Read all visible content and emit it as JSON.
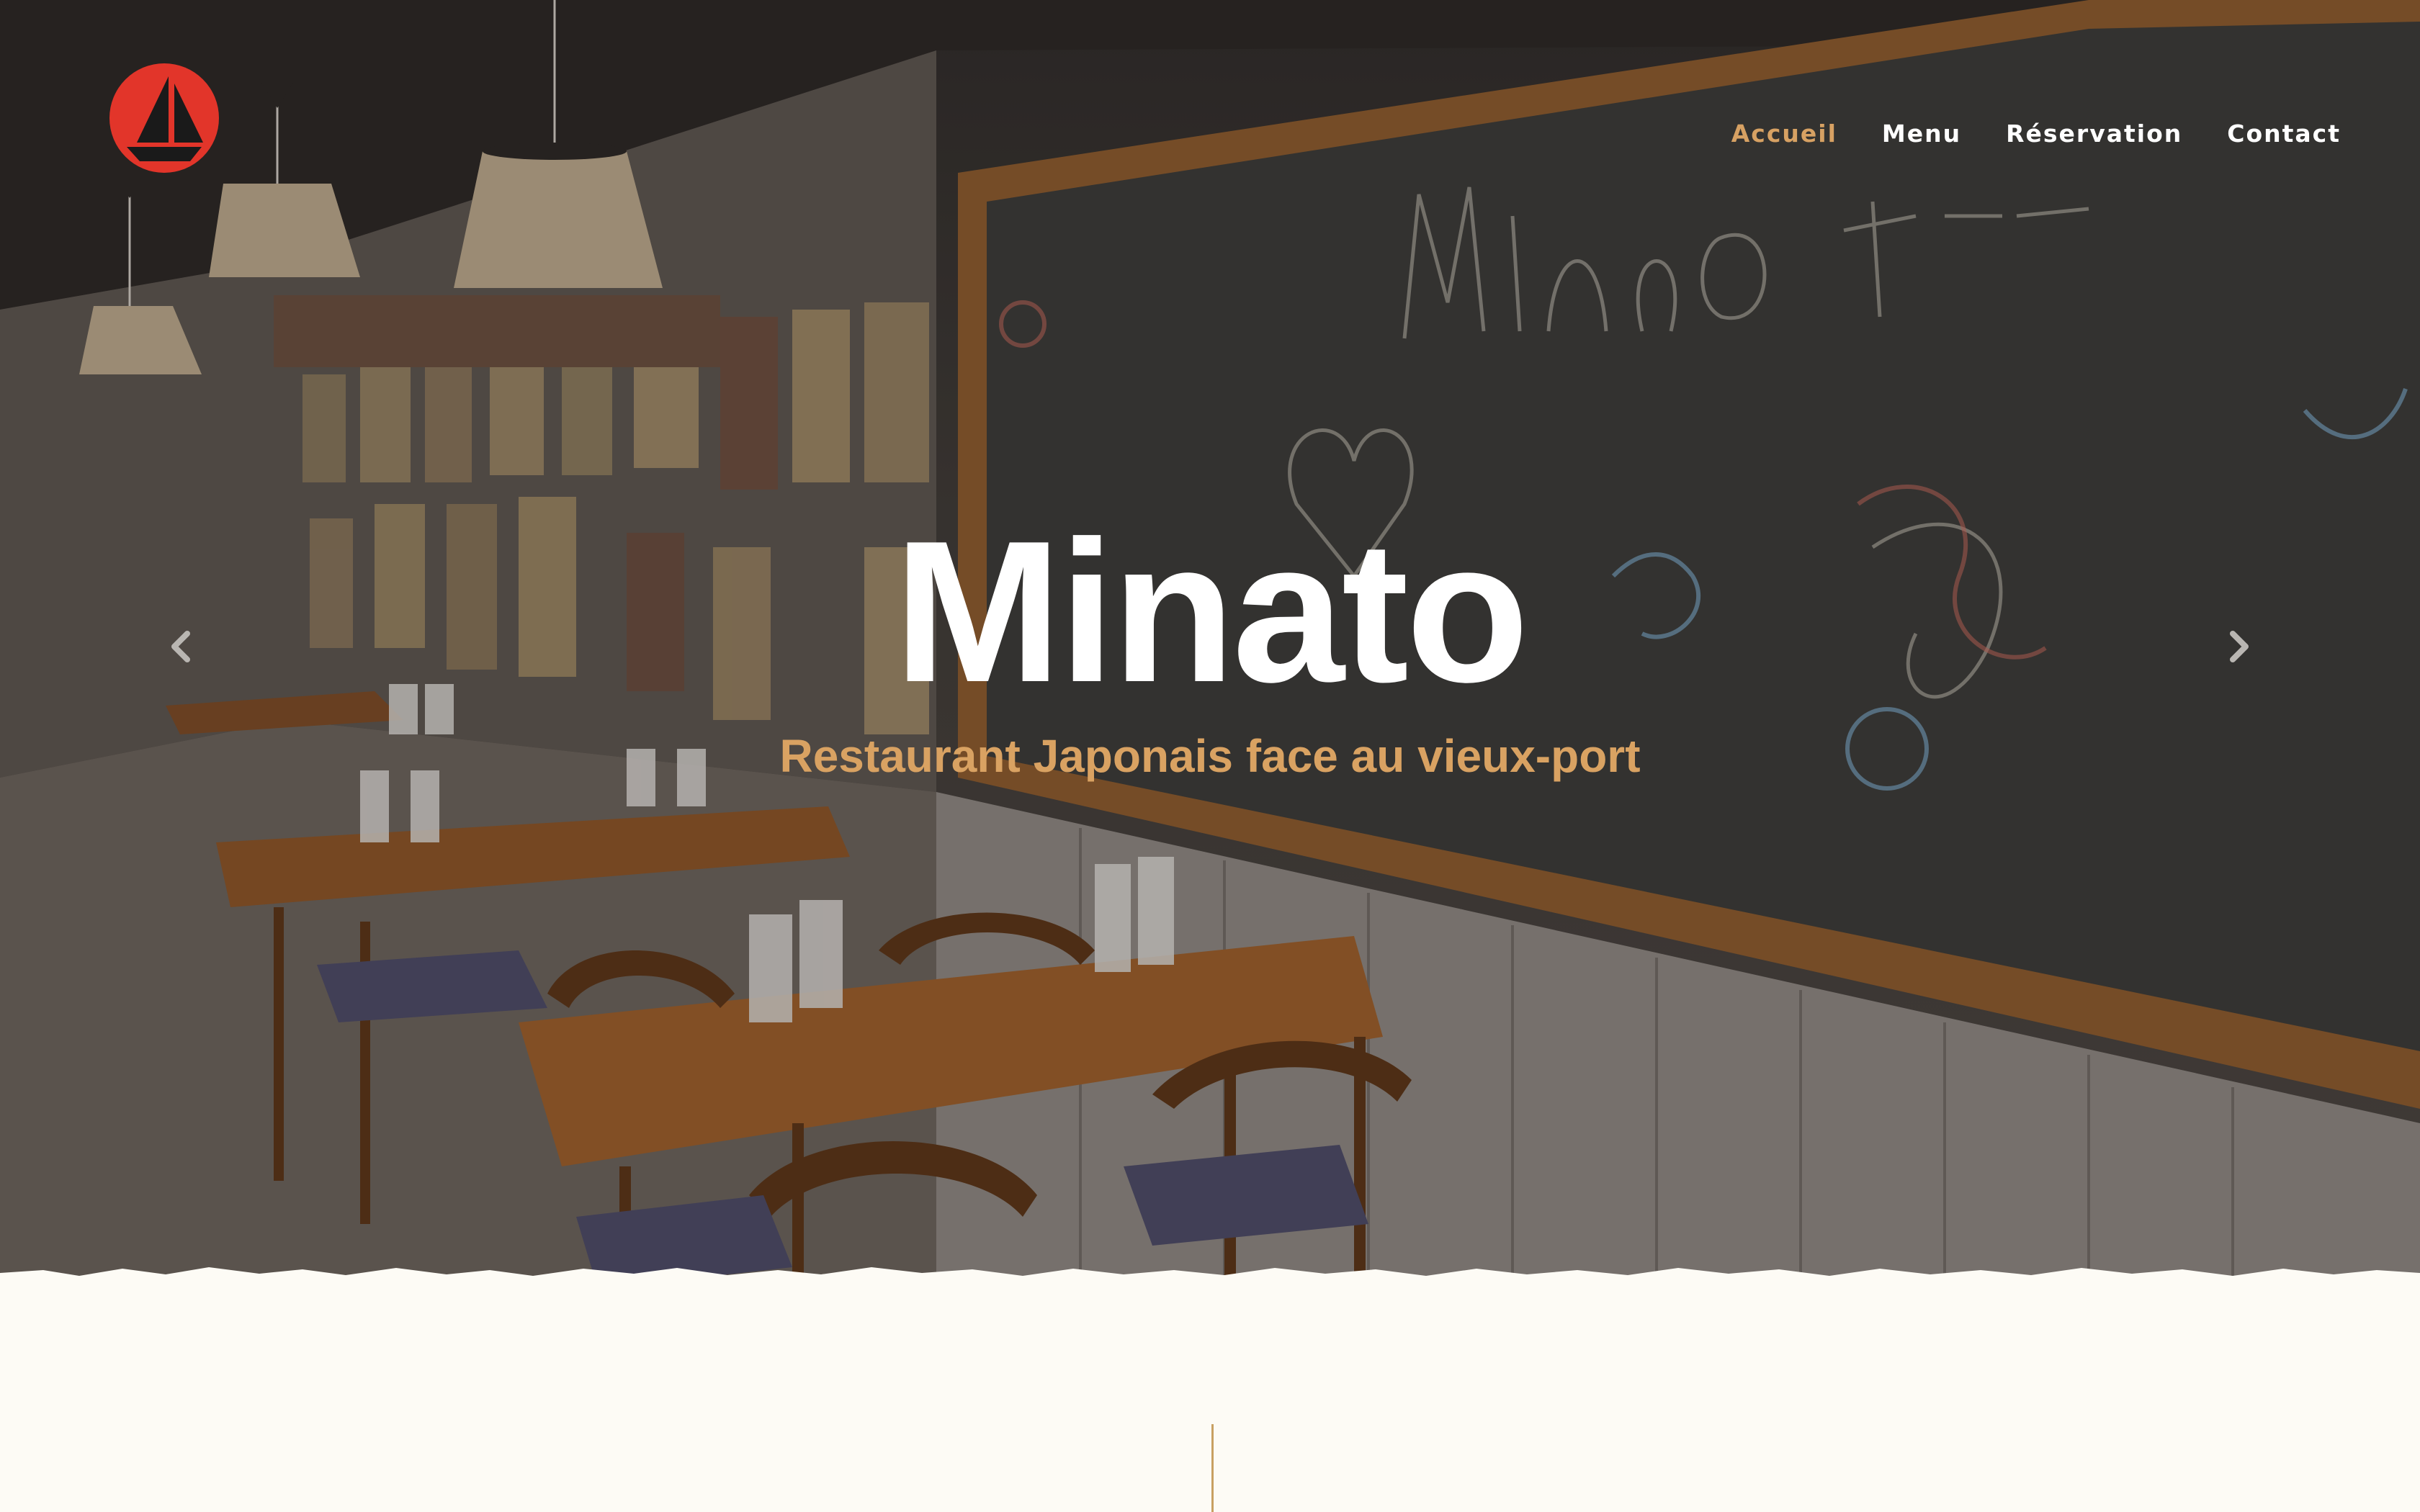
{
  "brand": {
    "logo_icon": "sailboat-logo-icon",
    "logo_color": "#e2352a"
  },
  "nav": {
    "items": [
      {
        "label": "Accueil",
        "active": true
      },
      {
        "label": "Menu",
        "active": false
      },
      {
        "label": "Réservation",
        "active": false
      },
      {
        "label": "Contact",
        "active": false
      }
    ],
    "active_color": "#d7a163"
  },
  "hero": {
    "title": "Minato",
    "subtitle": "Restaurant Japonais face au vieux-port",
    "subtitle_color": "#d9a262",
    "prev_icon": "chevron-left-icon",
    "next_icon": "chevron-right-icon"
  },
  "colors": {
    "page_background": "#fdfbf5",
    "divider": "#c8a062"
  }
}
